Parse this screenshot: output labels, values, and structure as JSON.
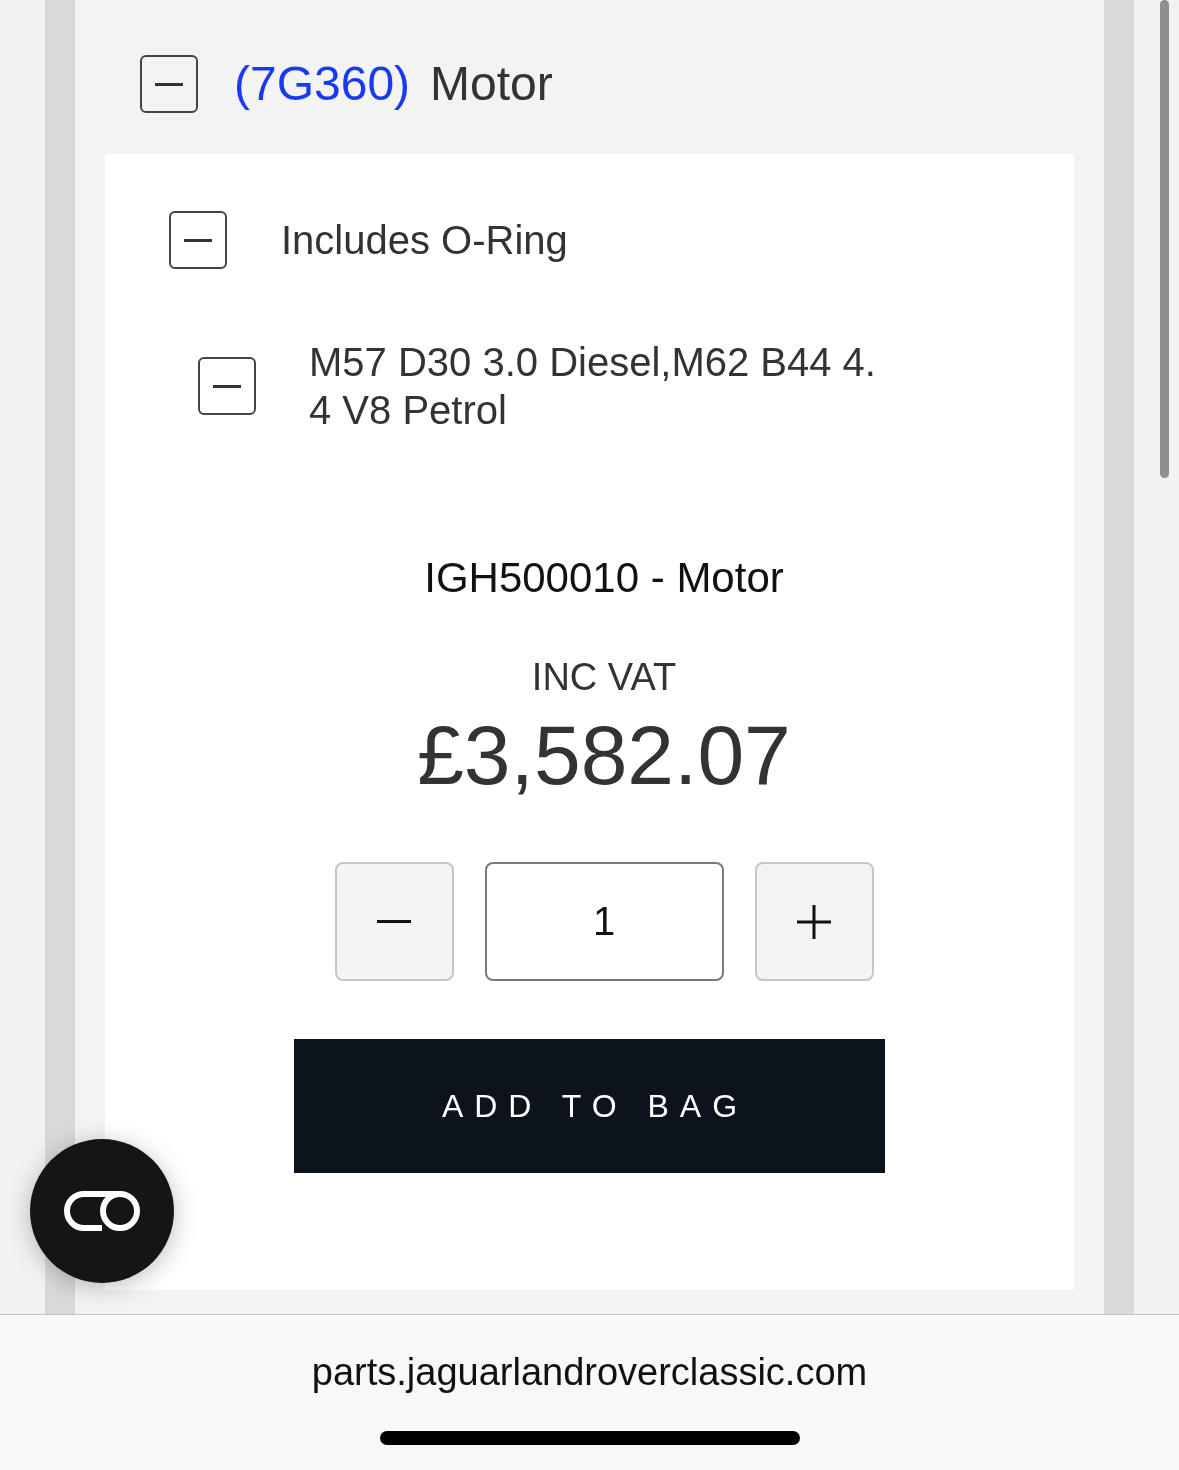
{
  "tree": [
    {
      "code": "(7G360)",
      "label": "Motor",
      "expanded": true,
      "children": [
        {
          "label": "Includes O-Ring",
          "expanded": true,
          "children": [
            {
              "label": "M57 D30 3.0 Diesel,M62 B44 4.4 V8 Petrol",
              "expanded": true
            }
          ]
        }
      ]
    }
  ],
  "product": {
    "title": "IGH500010 - Motor",
    "price_label": "INC VAT",
    "price": "£3,582.07",
    "quantity": "1",
    "add_button": "ADD TO BAG"
  },
  "browser": {
    "url": "parts.jaguarlandroverclassic.com"
  }
}
